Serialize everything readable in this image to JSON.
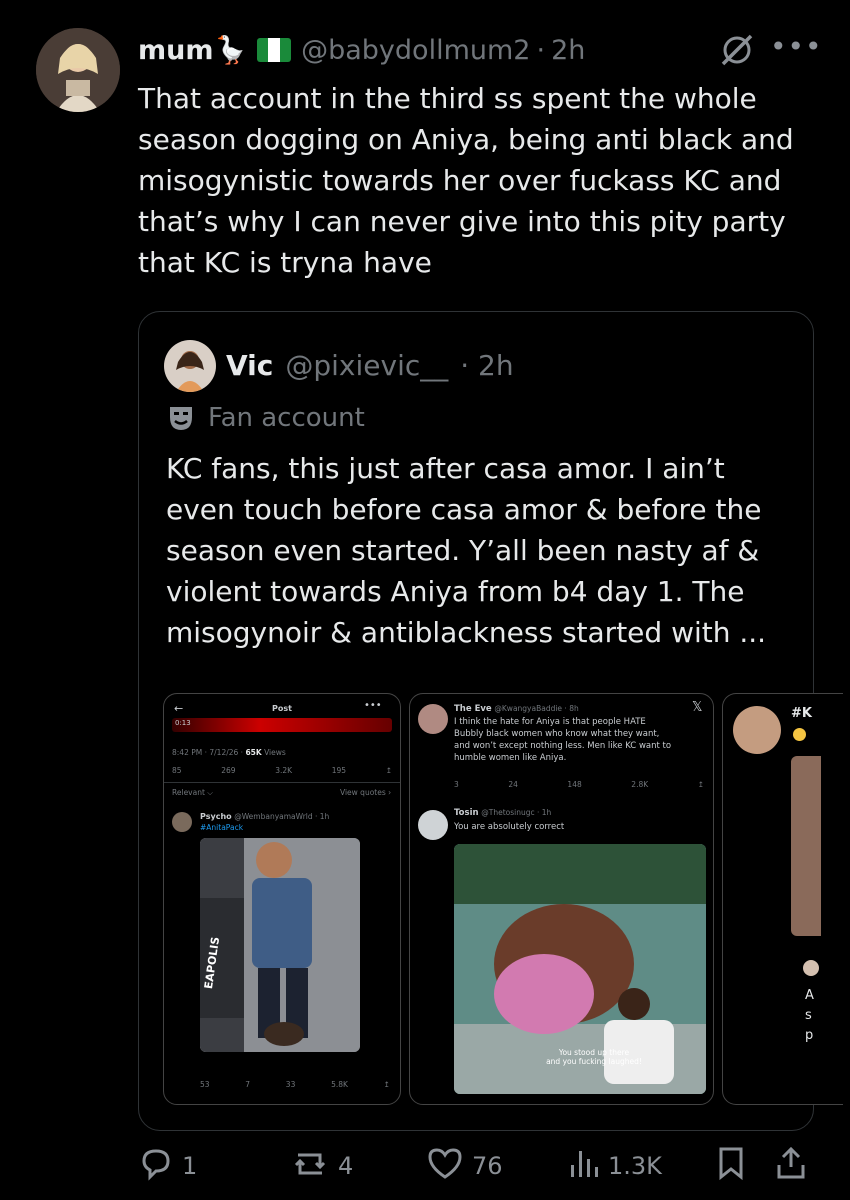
{
  "tweet": {
    "display_name": "mum🪿",
    "handle": "@babydollmum2",
    "separator": "·",
    "time": "2h",
    "flag_icon": "nigeria-flag-icon",
    "text_lines": [
      "That account in the third ss spent the whole",
      "season dogging on Aniya, being anti black and",
      "misogynistic towards her over fuckass KC and",
      "that’s why I can never give into this pity party",
      "that KC is tryna have"
    ]
  },
  "quote": {
    "display_name": "Vic",
    "handle": "@pixievic__",
    "time": "· 2h",
    "label": "Fan account",
    "label_icon": "theater-mask-icon",
    "text_lines": [
      "KC fans, this just after casa amor. I ain’t",
      "even touch before casa amor & before the",
      "season even started. Y’all been nasty af &",
      "violent towards Aniya from b4 day 1. The",
      "misogynoir & antiblackness started with ..."
    ]
  },
  "shot1": {
    "header": "Post",
    "time_label": "0:13",
    "meta_date": "8:42 PM · 7/12/26 · ",
    "views": "65K",
    "views_label": " Views",
    "stats": [
      "85",
      "269",
      "3.2K",
      "195"
    ],
    "relevant": "Relevant ⌵",
    "view_quotes": "View quotes ›",
    "reply_name": "Psycho",
    "reply_handle": "@WembanyamaWrld · 1h",
    "reply_tag": "#AnitaPack",
    "image_text": "EAPOLIS",
    "footer_stats": [
      "53",
      "7",
      "33",
      "5.8K"
    ]
  },
  "shot2": {
    "name": "The Eve",
    "handle": "@KwangyaBaddie · 8h",
    "text_lines": [
      "I think the hate for Aniya is that people HATE",
      "Bubbly black women who know what they want,",
      "and won’t except nothing less. Men like KC want to",
      "humble women like Aniya."
    ],
    "stats": [
      "3",
      "24",
      "148",
      "2.8K"
    ],
    "reply_name": "Tosin",
    "reply_handle": "@Thetosinugc · 1h",
    "reply_text": "You are absolutely correct",
    "caption_lines": [
      "You stood up there",
      "and you fucking laughed!"
    ]
  },
  "shot3": {
    "hashtag": "#K",
    "side_letters": [
      "A",
      "s",
      "p"
    ]
  },
  "actions": {
    "replies": "1",
    "reposts": "4",
    "likes": "76",
    "views": "1.3K"
  },
  "colors": {
    "background": "#000000",
    "text": "#e7e9ea",
    "muted": "#71767b",
    "border": "#2f3336",
    "link": "#1d9bf0"
  }
}
